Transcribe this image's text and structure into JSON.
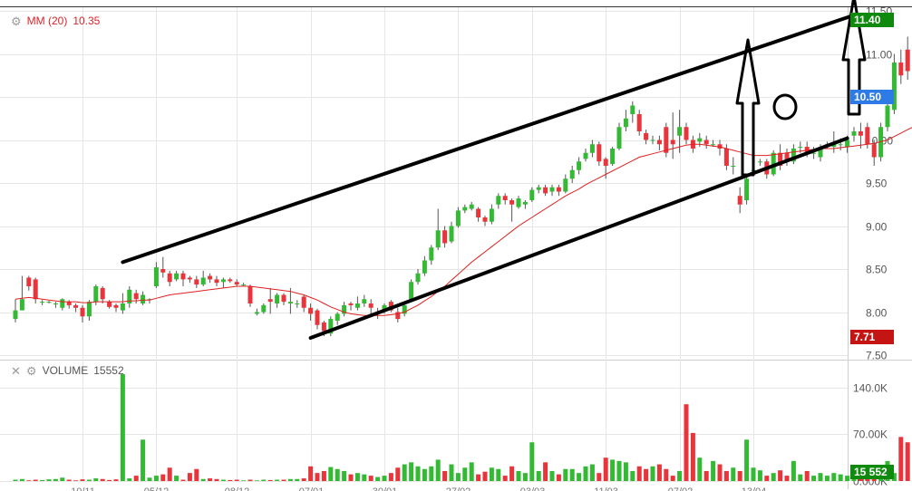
{
  "price_legend": {
    "label": "MM (20)",
    "value": "10.35"
  },
  "volume_legend": {
    "label": "VOLUME",
    "value": "15552"
  },
  "badges": {
    "last_high": "11.40",
    "current": "10.50",
    "ma_low": "7.71",
    "volume": "15 552"
  },
  "colors": {
    "up": "#33b933",
    "down": "#e8343a",
    "ma": "#e02020",
    "badge_green": "#0f8a0f",
    "badge_blue": "#2f7be5",
    "badge_red": "#c41414",
    "grid": "#e6e6e6"
  },
  "chart_data": [
    {
      "type": "candlestick",
      "title": "",
      "ylim": [
        7.5,
        11.5
      ],
      "y_ticks": [
        "7.50",
        "8.00",
        "8.50",
        "9.00",
        "9.50",
        "10.00",
        "10.50",
        "11.00",
        "11.50"
      ],
      "x_ticks": [
        "10/11",
        "05/12",
        "08/12",
        "07/01",
        "30/01",
        "27/02",
        "03/03",
        "11/03",
        "07/02",
        "13/04"
      ],
      "x_tick_index": [
        10,
        21,
        33,
        44,
        55,
        66,
        77,
        88,
        99,
        110
      ],
      "candles": [
        [
          7.92,
          8.02,
          7.88,
          8.15
        ],
        [
          8.02,
          8.15,
          8.1,
          8.42
        ],
        [
          8.4,
          8.3,
          8.25,
          8.42
        ],
        [
          8.38,
          8.15,
          8.1,
          8.4
        ],
        [
          8.12,
          8.12,
          8.08,
          8.14
        ],
        [
          8.12,
          8.12,
          8.1,
          8.13
        ],
        [
          8.1,
          8.1,
          8.05,
          8.12
        ],
        [
          8.05,
          8.15,
          8.02,
          8.16
        ],
        [
          8.12,
          8.08,
          8.04,
          8.14
        ],
        [
          8.08,
          8.05,
          8.0,
          8.1
        ],
        [
          8.05,
          7.95,
          7.88,
          8.08
        ],
        [
          7.95,
          8.12,
          7.9,
          8.14
        ],
        [
          8.12,
          8.3,
          8.08,
          8.32
        ],
        [
          8.28,
          8.15,
          8.1,
          8.3
        ],
        [
          8.12,
          8.06,
          8.04,
          8.14
        ],
        [
          8.08,
          8.05,
          8.0,
          8.1
        ],
        [
          8.02,
          8.1,
          7.98,
          8.22
        ],
        [
          8.1,
          8.26,
          8.05,
          8.3
        ],
        [
          8.22,
          8.15,
          8.1,
          8.26
        ],
        [
          8.1,
          8.2,
          8.08,
          8.24
        ],
        [
          8.15,
          8.15,
          8.1,
          8.16
        ],
        [
          8.3,
          8.52,
          8.28,
          8.58
        ],
        [
          8.5,
          8.46,
          8.4,
          8.64
        ],
        [
          8.45,
          8.35,
          8.3,
          8.48
        ],
        [
          8.38,
          8.45,
          8.36,
          8.48
        ],
        [
          8.45,
          8.38,
          8.3,
          8.48
        ],
        [
          8.4,
          8.38,
          8.34,
          8.42
        ],
        [
          8.38,
          8.32,
          8.28,
          8.42
        ],
        [
          8.32,
          8.4,
          8.3,
          8.48
        ],
        [
          8.42,
          8.38,
          8.34,
          8.45
        ],
        [
          8.38,
          8.34,
          8.3,
          8.42
        ],
        [
          8.35,
          8.38,
          8.28,
          8.4
        ],
        [
          8.38,
          8.36,
          8.34,
          8.4
        ],
        [
          8.35,
          8.32,
          8.3,
          8.38
        ],
        [
          8.32,
          8.32,
          8.3,
          8.34
        ],
        [
          8.3,
          8.1,
          8.06,
          8.32
        ],
        [
          7.98,
          8.0,
          7.96,
          8.04
        ],
        [
          8.0,
          8.08,
          7.98,
          8.1
        ],
        [
          8.15,
          8.12,
          7.98,
          8.28
        ],
        [
          8.1,
          8.2,
          8.05,
          8.22
        ],
        [
          8.2,
          8.12,
          8.08,
          8.22
        ],
        [
          8.1,
          8.12,
          7.98,
          8.28
        ],
        [
          8.1,
          8.1,
          8.05,
          8.14
        ],
        [
          8.18,
          8.05,
          8.0,
          8.2
        ],
        [
          8.05,
          7.98,
          7.9,
          8.1
        ],
        [
          8.02,
          7.85,
          7.8,
          8.04
        ],
        [
          7.88,
          7.78,
          7.72,
          7.9
        ],
        [
          7.75,
          7.92,
          7.72,
          7.95
        ],
        [
          7.9,
          7.98,
          7.85,
          8.0
        ],
        [
          7.98,
          8.08,
          7.95,
          8.12
        ],
        [
          8.1,
          8.08,
          8.02,
          8.12
        ],
        [
          8.05,
          8.1,
          8.02,
          8.18
        ],
        [
          8.1,
          8.15,
          8.06,
          8.2
        ],
        [
          8.1,
          8.05,
          7.95,
          8.15
        ],
        [
          7.98,
          8.0,
          7.92,
          8.05
        ],
        [
          8.02,
          8.08,
          7.98,
          8.1
        ],
        [
          8.12,
          8.02,
          8.0,
          8.14
        ],
        [
          8.0,
          7.92,
          7.88,
          8.05
        ],
        [
          7.98,
          8.08,
          7.95,
          8.1
        ],
        [
          8.15,
          8.35,
          8.12,
          8.38
        ],
        [
          8.35,
          8.45,
          8.32,
          8.5
        ],
        [
          8.45,
          8.6,
          8.42,
          8.65
        ],
        [
          8.6,
          8.75,
          8.55,
          8.78
        ],
        [
          8.75,
          8.95,
          8.72,
          9.2
        ],
        [
          8.95,
          8.8,
          8.75,
          9.0
        ],
        [
          8.82,
          9.0,
          8.8,
          9.05
        ],
        [
          9.0,
          9.18,
          8.98,
          9.22
        ],
        [
          9.18,
          9.22,
          9.15,
          9.25
        ],
        [
          9.2,
          9.25,
          9.18,
          9.28
        ],
        [
          9.2,
          9.1,
          9.05,
          9.22
        ],
        [
          9.1,
          9.05,
          9.0,
          9.12
        ],
        [
          9.05,
          9.2,
          9.02,
          9.25
        ],
        [
          9.25,
          9.35,
          9.2,
          9.38
        ],
        [
          9.35,
          9.3,
          9.25,
          9.38
        ],
        [
          9.3,
          9.25,
          9.05,
          9.32
        ],
        [
          9.22,
          9.32,
          9.2,
          9.35
        ],
        [
          9.25,
          9.28,
          9.2,
          9.3
        ],
        [
          9.3,
          9.42,
          9.28,
          9.45
        ],
        [
          9.42,
          9.45,
          9.38,
          9.48
        ],
        [
          9.45,
          9.38,
          9.35,
          9.48
        ],
        [
          9.4,
          9.45,
          9.35,
          9.48
        ],
        [
          9.45,
          9.4,
          9.35,
          9.48
        ],
        [
          9.4,
          9.55,
          9.38,
          9.6
        ],
        [
          9.55,
          9.65,
          9.5,
          9.7
        ],
        [
          9.65,
          9.75,
          9.6,
          9.8
        ],
        [
          9.78,
          9.85,
          9.75,
          9.9
        ],
        [
          9.85,
          9.95,
          9.8,
          10.0
        ],
        [
          9.95,
          9.75,
          9.7,
          9.98
        ],
        [
          9.78,
          9.7,
          9.55,
          9.8
        ],
        [
          9.72,
          9.9,
          9.7,
          9.92
        ],
        [
          9.9,
          10.15,
          9.88,
          10.2
        ],
        [
          10.15,
          10.25,
          10.1,
          10.35
        ],
        [
          10.3,
          10.4,
          10.2,
          10.45
        ],
        [
          10.3,
          10.1,
          10.05,
          10.35
        ],
        [
          10.08,
          10.0,
          9.95,
          10.12
        ],
        [
          10.0,
          10.0,
          9.95,
          10.05
        ],
        [
          10.0,
          9.95,
          9.88,
          10.05
        ],
        [
          10.15,
          9.85,
          9.8,
          10.2
        ],
        [
          10.0,
          9.95,
          9.78,
          10.32
        ],
        [
          10.05,
          10.15,
          9.85,
          10.35
        ],
        [
          10.15,
          10.0,
          9.95,
          10.2
        ],
        [
          10.0,
          9.9,
          9.85,
          10.05
        ],
        [
          9.98,
          10.02,
          9.92,
          10.08
        ],
        [
          10.0,
          9.95,
          9.9,
          10.05
        ],
        [
          9.95,
          9.95,
          9.92,
          10.0
        ],
        [
          9.95,
          9.9,
          9.82,
          10.0
        ],
        [
          9.9,
          9.7,
          9.65,
          9.95
        ],
        [
          9.7,
          9.7,
          9.6,
          9.8
        ],
        [
          9.35,
          9.25,
          9.15,
          9.45
        ],
        [
          9.3,
          9.55,
          9.25,
          9.6
        ],
        [
          9.65,
          9.65,
          9.6,
          9.7
        ],
        [
          9.75,
          9.75,
          9.7,
          9.78
        ],
        [
          9.75,
          9.6,
          9.55,
          9.78
        ],
        [
          9.6,
          9.85,
          9.58,
          9.88
        ],
        [
          9.85,
          9.7,
          9.65,
          9.95
        ],
        [
          9.85,
          9.75,
          9.7,
          9.9
        ],
        [
          9.75,
          9.9,
          9.72,
          9.95
        ],
        [
          9.92,
          9.92,
          9.85,
          9.98
        ],
        [
          9.92,
          9.85,
          9.8,
          9.98
        ],
        [
          9.85,
          9.85,
          9.78,
          9.92
        ],
        [
          9.8,
          9.9,
          9.75,
          9.95
        ],
        [
          9.92,
          9.95,
          9.9,
          9.98
        ],
        [
          9.92,
          9.95,
          9.85,
          10.1
        ],
        [
          9.95,
          9.95,
          9.88,
          10.02
        ],
        [
          9.92,
          10.0,
          9.85,
          10.05
        ],
        [
          10.05,
          10.1,
          9.98,
          10.15
        ],
        [
          10.1,
          10.05,
          9.9,
          10.2
        ],
        [
          10.15,
          9.95,
          9.9,
          10.2
        ],
        [
          9.95,
          9.8,
          9.7,
          10.0
        ],
        [
          9.8,
          10.15,
          9.75,
          10.2
        ],
        [
          10.15,
          10.4,
          10.1,
          10.45
        ],
        [
          10.35,
          10.9,
          10.3,
          11.0
        ],
        [
          10.9,
          10.75,
          10.65,
          11.05
        ],
        [
          11.05,
          10.8,
          10.7,
          11.2
        ],
        [
          10.8,
          10.65,
          10.6,
          10.85
        ],
        [
          10.95,
          10.8,
          10.75,
          11.0
        ],
        [
          10.8,
          10.7,
          10.6,
          10.85
        ],
        [
          10.7,
          10.75,
          10.65,
          10.9
        ],
        [
          10.75,
          10.82,
          10.7,
          10.95
        ],
        [
          10.82,
          10.8,
          10.75,
          10.95
        ],
        [
          10.8,
          10.75,
          10.7,
          10.85
        ],
        [
          10.75,
          10.55,
          10.5,
          10.8
        ]
      ],
      "ma": [
        8.15,
        8.16,
        8.17,
        8.16,
        8.15,
        8.14,
        8.13,
        8.12,
        8.12,
        8.12,
        8.11,
        8.11,
        8.12,
        8.12,
        8.12,
        8.12,
        8.12,
        8.13,
        8.13,
        8.14,
        8.14,
        8.16,
        8.18,
        8.2,
        8.21,
        8.22,
        8.23,
        8.24,
        8.25,
        8.26,
        8.27,
        8.28,
        8.29,
        8.3,
        8.3,
        8.3,
        8.29,
        8.28,
        8.27,
        8.26,
        8.25,
        8.24,
        8.22,
        8.2,
        8.17,
        8.14,
        8.1,
        8.06,
        8.03,
        8.0,
        7.98,
        7.97,
        7.96,
        7.96,
        7.96,
        7.96,
        7.97,
        7.98,
        8.0,
        8.04,
        8.08,
        8.13,
        8.18,
        8.24,
        8.3,
        8.37,
        8.44,
        8.51,
        8.58,
        8.64,
        8.7,
        8.76,
        8.82,
        8.88,
        8.94,
        9.0,
        9.05,
        9.1,
        9.15,
        9.2,
        9.25,
        9.3,
        9.35,
        9.39,
        9.43,
        9.48,
        9.52,
        9.56,
        9.6,
        9.64,
        9.68,
        9.72,
        9.76,
        9.8,
        9.82,
        9.84,
        9.86,
        9.88,
        9.9,
        9.92,
        9.94,
        9.95,
        9.95,
        9.94,
        9.93,
        9.92,
        9.9,
        9.88,
        9.86,
        9.84,
        9.82,
        9.82,
        9.82,
        9.83,
        9.84,
        9.85,
        9.86,
        9.87,
        9.88,
        9.89,
        9.9,
        9.9,
        9.9,
        9.91,
        9.92,
        9.93,
        9.94,
        9.95,
        9.96,
        9.98,
        10.0,
        10.04,
        10.08,
        10.12,
        10.16,
        10.2,
        10.24,
        10.28,
        10.31,
        10.34,
        10.37,
        10.4,
        10.42,
        10.45
      ],
      "trend_lines": [
        {
          "from": [
            16,
            8.58
          ],
          "to": [
            125,
            11.45
          ]
        },
        {
          "from": [
            44,
            7.7
          ],
          "to": [
            124,
            10.02
          ]
        }
      ]
    },
    {
      "type": "bar",
      "title": "",
      "ylim": [
        0,
        175000
      ],
      "y_ticks": [
        "0.000K",
        "70.00K",
        "140.0K"
      ],
      "volume_colors": "up/down matches candles",
      "values": [
        2000,
        3000,
        1000,
        2000,
        1500,
        2500,
        3000,
        5000,
        2000,
        1000,
        2500,
        2000,
        4000,
        3000,
        1500,
        2500,
        160000,
        4000,
        8000,
        62000,
        5000,
        8000,
        10000,
        20000,
        8000,
        2000,
        12000,
        18000,
        3000,
        4000,
        3000,
        2000,
        1500,
        2000,
        1000,
        2000,
        1000,
        2000,
        1500,
        2000,
        2000,
        3000,
        3000,
        4000,
        22000,
        12000,
        15000,
        21000,
        18000,
        15000,
        10000,
        12000,
        10000,
        8000,
        6000,
        8000,
        12000,
        20000,
        25000,
        28000,
        22000,
        18000,
        22000,
        32000,
        15000,
        25000,
        12000,
        20000,
        28000,
        10000,
        14000,
        20000,
        18000,
        8000,
        22000,
        15000,
        12000,
        58000,
        15000,
        28000,
        15000,
        10000,
        18000,
        18000,
        12000,
        22000,
        25000,
        12000,
        35000,
        32000,
        30000,
        28000,
        15000,
        22000,
        18000,
        22000,
        25000,
        18000,
        8000,
        15000,
        115000,
        72000,
        35000,
        15000,
        30000,
        25000,
        15000,
        20000,
        15000,
        62000,
        20000,
        16000,
        8000,
        12000,
        16000,
        8000,
        30000,
        10000,
        15000,
        8000,
        12000,
        8000,
        12000,
        10000,
        8000,
        12000,
        6000,
        8000,
        12000,
        20000,
        30000,
        12000,
        66000,
        58000,
        20000,
        32000,
        12000,
        20000,
        14000,
        16000,
        12000,
        15552
      ]
    }
  ]
}
